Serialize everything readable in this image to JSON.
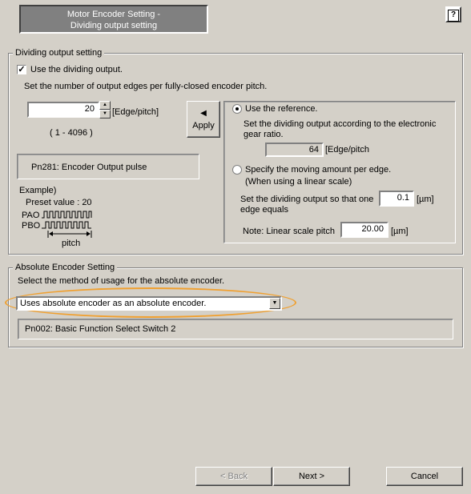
{
  "header": {
    "title_line1": "Motor Encoder Setting -",
    "title_line2": "Dividing output setting",
    "help_icon": "question-mark-icon",
    "help_label": "?"
  },
  "dividing": {
    "group_label": "Dividing output setting",
    "use_dividing_label": "Use the dividing output.",
    "use_dividing_checked": true,
    "instruction": "Set the number of output edges per fully-closed encoder pitch.",
    "edges_value": "20",
    "edges_unit": "[Edge/pitch]",
    "range": "( 1 - 4096 )",
    "apply_label": "Apply",
    "apply_icon": "arrow-left-icon",
    "param_label": "Pn281: Encoder Output pulse",
    "example_title": "Example)",
    "example_preset": "Preset value : 20",
    "pao_label": "PAO",
    "pbo_label": "PBO",
    "pitch_label": "pitch",
    "ref_radio_label": "Use the reference.",
    "ref_desc_line1": "Set the dividing output according to the electronic",
    "ref_desc_line2": "gear ratio.",
    "ref_value": "64",
    "ref_unit": "[Edge/pitch",
    "move_radio_label": "Specify the moving amount per edge.",
    "move_radio_sub": "(When using a linear scale)",
    "move_desc_line1": "Set the dividing output so that one",
    "move_desc_line2": "edge equals",
    "move_value": "0.1",
    "move_unit": "[µm]",
    "note_label": "Note: Linear scale pitch",
    "note_value": "20.00",
    "note_unit": "[µm]"
  },
  "absolute": {
    "group_label": "Absolute Encoder Setting",
    "instruction": "Select the method of usage for the absolute encoder.",
    "selected": "Uses absolute encoder as an absolute encoder.",
    "param_label": "Pn002: Basic Function Select Switch 2",
    "highlight_color": "#f0a030"
  },
  "footer": {
    "back_label": "< Back",
    "next_label": "Next >",
    "cancel_label": "Cancel"
  }
}
